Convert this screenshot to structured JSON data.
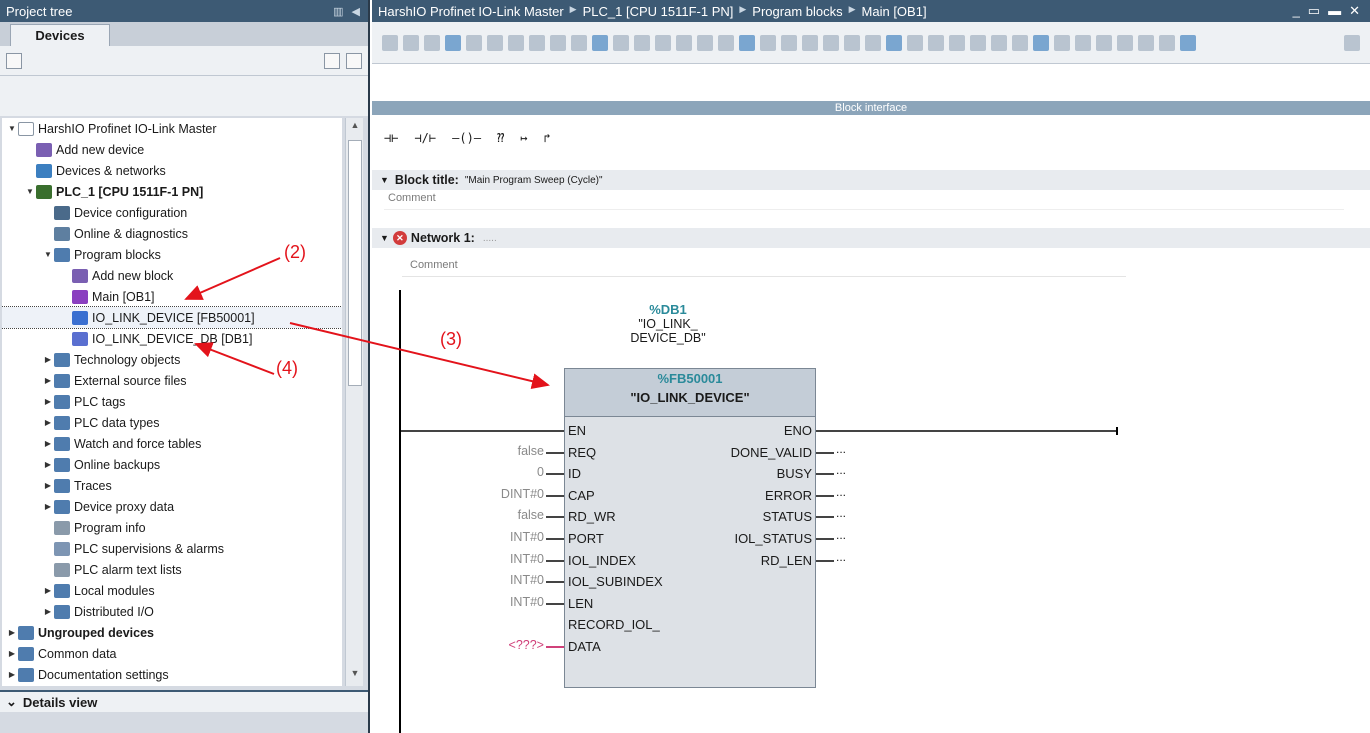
{
  "project_tree": {
    "title": "Project tree",
    "tab": "Devices",
    "items": [
      {
        "label": "HarshIO Profinet IO-Link Master",
        "indent": 0,
        "tri": "down",
        "icon": "project-icon",
        "bold": false
      },
      {
        "label": "Add new device",
        "indent": 1,
        "tri": "",
        "icon": "add-device-icon",
        "bold": false
      },
      {
        "label": "Devices & networks",
        "indent": 1,
        "tri": "",
        "icon": "network-icon",
        "bold": false
      },
      {
        "label": "PLC_1 [CPU 1511F-1 PN]",
        "indent": 1,
        "tri": "down",
        "icon": "plc-icon",
        "bold": true
      },
      {
        "label": "Device configuration",
        "indent": 2,
        "tri": "",
        "icon": "config-icon",
        "bold": false
      },
      {
        "label": "Online & diagnostics",
        "indent": 2,
        "tri": "",
        "icon": "diagnostics-icon",
        "bold": false
      },
      {
        "label": "Program blocks",
        "indent": 2,
        "tri": "down",
        "icon": "folder-icon",
        "bold": false
      },
      {
        "label": "Add new block",
        "indent": 3,
        "tri": "",
        "icon": "add-block-icon",
        "bold": false
      },
      {
        "label": "Main [OB1]",
        "indent": 3,
        "tri": "",
        "icon": "ob-icon",
        "bold": false
      },
      {
        "label": "IO_LINK_DEVICE [FB50001]",
        "indent": 3,
        "tri": "",
        "icon": "fb-icon",
        "bold": false,
        "selected": true
      },
      {
        "label": "IO_LINK_DEVICE_DB [DB1]",
        "indent": 3,
        "tri": "",
        "icon": "db-icon",
        "bold": false
      },
      {
        "label": "Technology objects",
        "indent": 2,
        "tri": "right",
        "icon": "folder-icon",
        "bold": false
      },
      {
        "label": "External source files",
        "indent": 2,
        "tri": "right",
        "icon": "folder-icon",
        "bold": false
      },
      {
        "label": "PLC tags",
        "indent": 2,
        "tri": "right",
        "icon": "folder-icon",
        "bold": false
      },
      {
        "label": "PLC data types",
        "indent": 2,
        "tri": "right",
        "icon": "folder-icon",
        "bold": false
      },
      {
        "label": "Watch and force tables",
        "indent": 2,
        "tri": "right",
        "icon": "folder-icon",
        "bold": false
      },
      {
        "label": "Online backups",
        "indent": 2,
        "tri": "right",
        "icon": "folder-icon",
        "bold": false
      },
      {
        "label": "Traces",
        "indent": 2,
        "tri": "right",
        "icon": "folder-icon",
        "bold": false
      },
      {
        "label": "Device proxy data",
        "indent": 2,
        "tri": "right",
        "icon": "folder-icon",
        "bold": false
      },
      {
        "label": "Program info",
        "indent": 2,
        "tri": "",
        "icon": "info-icon",
        "bold": false
      },
      {
        "label": "PLC supervisions & alarms",
        "indent": 2,
        "tri": "",
        "icon": "alarm-icon",
        "bold": false
      },
      {
        "label": "PLC alarm text lists",
        "indent": 2,
        "tri": "",
        "icon": "list-icon",
        "bold": false
      },
      {
        "label": "Local modules",
        "indent": 2,
        "tri": "right",
        "icon": "folder-icon",
        "bold": false
      },
      {
        "label": "Distributed I/O",
        "indent": 2,
        "tri": "right",
        "icon": "folder-icon",
        "bold": false
      },
      {
        "label": "Ungrouped devices",
        "indent": 0,
        "tri": "right",
        "icon": "folder-icon",
        "bold": true
      },
      {
        "label": "Common data",
        "indent": 0,
        "tri": "right",
        "icon": "folder-icon",
        "bold": false
      },
      {
        "label": "Documentation settings",
        "indent": 0,
        "tri": "right",
        "icon": "folder-icon",
        "bold": false
      }
    ],
    "details_view": "Details view"
  },
  "editor": {
    "breadcrumbs": [
      "HarshIO Profinet IO-Link Master",
      "PLC_1 [CPU 1511F-1 PN]",
      "Program blocks",
      "Main [OB1]"
    ],
    "block_interface": "Block interface",
    "ladder_tools": [
      "⊣⊢",
      "⊣/⊢",
      "–()–",
      "⁇",
      "↦",
      "↱"
    ],
    "block_title_label": "Block title:",
    "block_title_value": "\"Main Program Sweep (Cycle)\"",
    "comment": "Comment",
    "network_label": "Network 1:",
    "network_value": ".....",
    "fb": {
      "db_number": "%DB1",
      "db_name_line1": "\"IO_LINK_",
      "db_name_line2": "DEVICE_DB\"",
      "fb_number": "%FB50001",
      "fb_name": "\"IO_LINK_DEVICE\"",
      "inputs": [
        {
          "pin": "EN",
          "value": ""
        },
        {
          "pin": "REQ",
          "value": "false"
        },
        {
          "pin": "ID",
          "value": "0"
        },
        {
          "pin": "CAP",
          "value": "DINT#0"
        },
        {
          "pin": "RD_WR",
          "value": "false"
        },
        {
          "pin": "PORT",
          "value": "INT#0"
        },
        {
          "pin": "IOL_INDEX",
          "value": "INT#0"
        },
        {
          "pin": "IOL_SUBINDEX",
          "value": "INT#0"
        },
        {
          "pin": "LEN",
          "value": "INT#0"
        },
        {
          "pin": "RECORD_IOL_",
          "value": ""
        },
        {
          "pin": "DATA",
          "value": "<???>"
        }
      ],
      "outputs": [
        {
          "pin": "ENO",
          "value": ""
        },
        {
          "pin": "DONE_VALID",
          "value": "..."
        },
        {
          "pin": "BUSY",
          "value": "..."
        },
        {
          "pin": "ERROR",
          "value": "..."
        },
        {
          "pin": "STATUS",
          "value": "..."
        },
        {
          "pin": "IOL_STATUS",
          "value": "..."
        },
        {
          "pin": "RD_LEN",
          "value": "..."
        }
      ]
    }
  },
  "annotations": [
    "(2)",
    "(3)",
    "(4)"
  ],
  "colors": {
    "header_bg": "#3d5a74",
    "accent_teal": "#2a8a9a",
    "annotation_red": "#e3131b"
  }
}
